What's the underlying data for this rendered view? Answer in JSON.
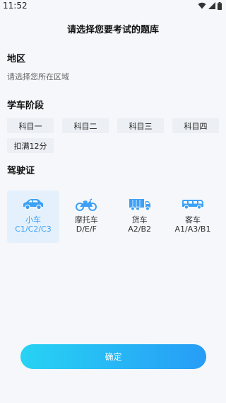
{
  "status_bar": {
    "time": "11:52"
  },
  "header": {
    "title": "请选择您要考试的题库"
  },
  "region": {
    "title": "地区",
    "placeholder": "请选择您所在区域"
  },
  "stage": {
    "title": "学车阶段",
    "options": [
      "科目一",
      "科目二",
      "科目三",
      "科目四",
      "扣满12分"
    ]
  },
  "license": {
    "title": "驾驶证",
    "options": [
      {
        "name": "小车",
        "code": "C1/C2/C3",
        "icon": "car-icon",
        "selected": true
      },
      {
        "name": "摩托车",
        "code": "D/E/F",
        "icon": "motorcycle-icon",
        "selected": false
      },
      {
        "name": "货车",
        "code": "A2/B2",
        "icon": "truck-icon",
        "selected": false
      },
      {
        "name": "客车",
        "code": "A1/A3/B1",
        "icon": "bus-icon",
        "selected": false
      }
    ]
  },
  "confirm": {
    "label": "确定"
  },
  "colors": {
    "accent": "#3ca0f6",
    "button_start": "#27d3f3",
    "button_end": "#279cf7"
  }
}
